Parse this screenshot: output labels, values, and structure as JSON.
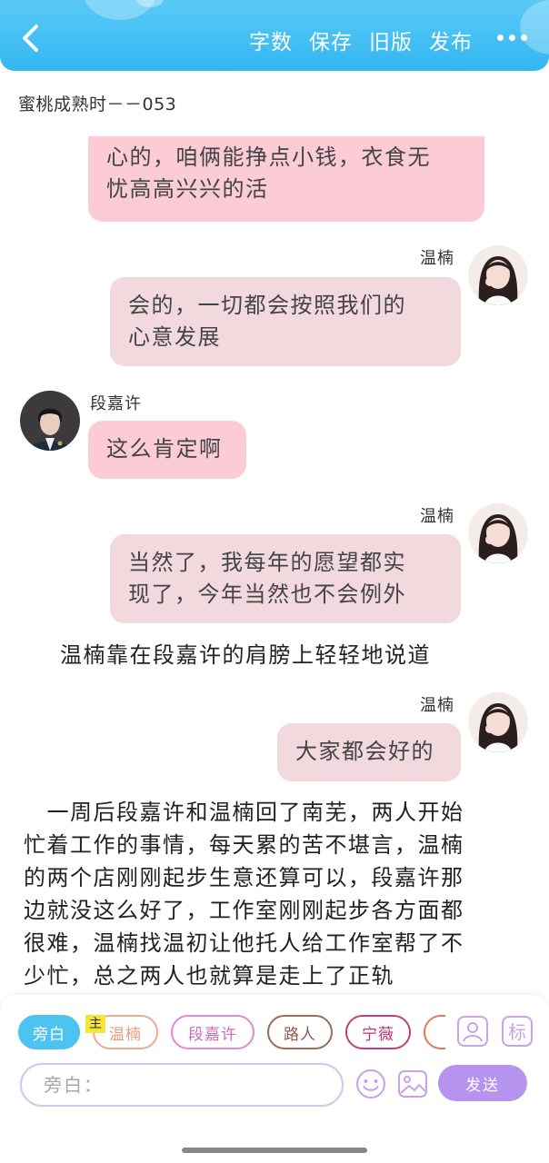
{
  "header": {
    "actions": [
      "字数",
      "保存",
      "旧版",
      "发布"
    ],
    "colors": {
      "bar": "#34b7f1"
    }
  },
  "chapter_title": "蜜桃成熟时－－053",
  "messages": [
    {
      "type": "bubble",
      "side": "left",
      "color": "pink",
      "lines": [
        "心的，咱俩能挣点小钱，衣食无",
        "忧高高兴兴的活"
      ]
    },
    {
      "type": "bubble",
      "side": "right",
      "speaker": "温楠",
      "color": "grey",
      "lines": [
        "会的，一切都会按照我们的",
        "心意发展"
      ]
    },
    {
      "type": "bubble",
      "side": "left",
      "speaker": "段嘉许",
      "color": "pink",
      "lines": [
        "这么肯定啊"
      ]
    },
    {
      "type": "bubble",
      "side": "right",
      "speaker": "温楠",
      "color": "grey",
      "lines": [
        "当然了，我每年的愿望都实",
        "现了，今年当然也不会例外"
      ]
    },
    {
      "type": "narration",
      "lines": [
        "温楠靠在段嘉许的肩膀上轻轻地说道"
      ]
    },
    {
      "type": "bubble",
      "side": "right",
      "speaker": "温楠",
      "color": "grey",
      "lines": [
        "大家都会好的"
      ]
    },
    {
      "type": "narration",
      "lines": [
        "　一周后段嘉许和温楠回了南芜，两人开始",
        "忙着工作的事情，每天累的苦不堪言，温楠",
        "的两个店刚刚起步生意还算可以，段嘉许那",
        "边就没这么好了，工作室刚刚起步各方面都",
        "很难，温楠找温初让他托人给工作室帮了不",
        "少忙，总之两人也就算是走上了正轨"
      ]
    }
  ],
  "composer": {
    "roles": [
      {
        "label": "旁白",
        "color": "#4cc3f0",
        "active": true
      },
      {
        "label": "温楠",
        "color": "#f0a98c",
        "main_tag": "主"
      },
      {
        "label": "段嘉许",
        "color": "#e08ad6"
      },
      {
        "label": "路人",
        "color": "#9a6b5a"
      },
      {
        "label": "宁薇",
        "color": "#c2407a"
      },
      {
        "label": "",
        "color": "#e0795a"
      }
    ],
    "tools": [
      "person-icon",
      "mark-icon"
    ],
    "tool_mark_label": "标",
    "input_placeholder": "旁白：",
    "send_label": "发送"
  }
}
